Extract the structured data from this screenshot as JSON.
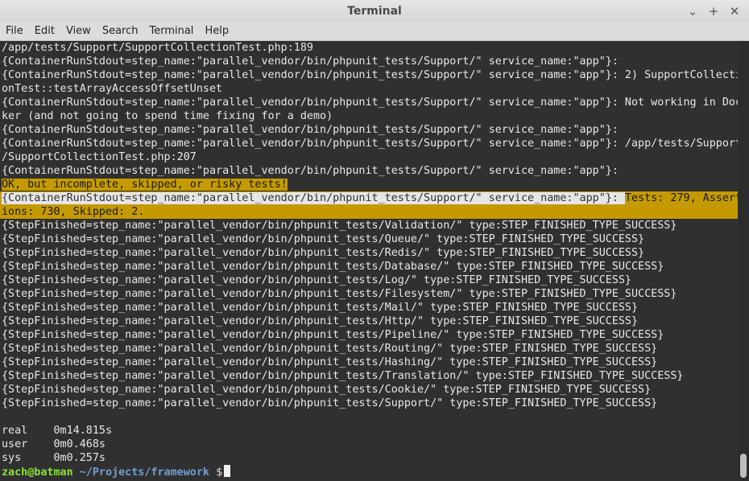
{
  "window": {
    "title": "Terminal",
    "controls": [
      "⌄",
      "+",
      "✕"
    ]
  },
  "menu": [
    "File",
    "Edit",
    "View",
    "Search",
    "Terminal",
    "Help"
  ],
  "terminal": {
    "lines": [
      {
        "text": "/app/tests/Support/SupportCollectionTest.php:189"
      },
      {
        "text": "{ContainerRunStdout=step_name:\"parallel_vendor/bin/phpunit_tests/Support/\" service_name:\"app\"}:"
      },
      {
        "text": "{ContainerRunStdout=step_name:\"parallel_vendor/bin/phpunit_tests/Support/\" service_name:\"app\"}: 2) SupportCollecti"
      },
      {
        "text": "onTest::testArrayAccessOffsetUnset"
      },
      {
        "text": "{ContainerRunStdout=step_name:\"parallel_vendor/bin/phpunit_tests/Support/\" service_name:\"app\"}: Not working in Doc"
      },
      {
        "text": "ker (and not going to spend time fixing for a demo)"
      },
      {
        "text": "{ContainerRunStdout=step_name:\"parallel_vendor/bin/phpunit_tests/Support/\" service_name:\"app\"}:"
      },
      {
        "text": "{ContainerRunStdout=step_name:\"parallel_vendor/bin/phpunit_tests/Support/\" service_name:\"app\"}: /app/tests/Support"
      },
      {
        "text": "/SupportCollectionTest.php:207"
      },
      {
        "text": "{ContainerRunStdout=step_name:\"parallel_vendor/bin/phpunit_tests/Support/\" service_name:\"app\"}:"
      },
      {
        "text": "OK, but incomplete, skipped, or risky tests!",
        "hl": "full"
      },
      {
        "text": "{ContainerRunStdout=step_name:\"parallel_vendor/bin/phpunit_tests/Support/\" service_name:\"app\"}: ",
        "hl": "label",
        "rest": "Tests: 279, Assert"
      },
      {
        "text": "ions: 730, Skipped: 2.",
        "hl": "row"
      },
      {
        "text": "{StepFinished=step_name:\"parallel_vendor/bin/phpunit_tests/Validation/\" type:STEP_FINISHED_TYPE_SUCCESS}"
      },
      {
        "text": "{StepFinished=step_name:\"parallel_vendor/bin/phpunit_tests/Queue/\" type:STEP_FINISHED_TYPE_SUCCESS}"
      },
      {
        "text": "{StepFinished=step_name:\"parallel_vendor/bin/phpunit_tests/Redis/\" type:STEP_FINISHED_TYPE_SUCCESS}"
      },
      {
        "text": "{StepFinished=step_name:\"parallel_vendor/bin/phpunit_tests/Database/\" type:STEP_FINISHED_TYPE_SUCCESS}"
      },
      {
        "text": "{StepFinished=step_name:\"parallel_vendor/bin/phpunit_tests/Log/\" type:STEP_FINISHED_TYPE_SUCCESS}"
      },
      {
        "text": "{StepFinished=step_name:\"parallel_vendor/bin/phpunit_tests/Filesystem/\" type:STEP_FINISHED_TYPE_SUCCESS}"
      },
      {
        "text": "{StepFinished=step_name:\"parallel_vendor/bin/phpunit_tests/Mail/\" type:STEP_FINISHED_TYPE_SUCCESS}"
      },
      {
        "text": "{StepFinished=step_name:\"parallel_vendor/bin/phpunit_tests/Http/\" type:STEP_FINISHED_TYPE_SUCCESS}"
      },
      {
        "text": "{StepFinished=step_name:\"parallel_vendor/bin/phpunit_tests/Pipeline/\" type:STEP_FINISHED_TYPE_SUCCESS}"
      },
      {
        "text": "{StepFinished=step_name:\"parallel_vendor/bin/phpunit_tests/Routing/\" type:STEP_FINISHED_TYPE_SUCCESS}"
      },
      {
        "text": "{StepFinished=step_name:\"parallel_vendor/bin/phpunit_tests/Hashing/\" type:STEP_FINISHED_TYPE_SUCCESS}"
      },
      {
        "text": "{StepFinished=step_name:\"parallel_vendor/bin/phpunit_tests/Translation/\" type:STEP_FINISHED_TYPE_SUCCESS}"
      },
      {
        "text": "{StepFinished=step_name:\"parallel_vendor/bin/phpunit_tests/Cookie/\" type:STEP_FINISHED_TYPE_SUCCESS}"
      },
      {
        "text": "{StepFinished=step_name:\"parallel_vendor/bin/phpunit_tests/Support/\" type:STEP_FINISHED_TYPE_SUCCESS}"
      },
      {
        "text": ""
      },
      {
        "text": "real    0m14.815s"
      },
      {
        "text": "user    0m0.468s"
      },
      {
        "text": "sys     0m0.257s"
      }
    ],
    "prompt": {
      "user_host": "zach@batman",
      "path": "~/Projects/framework",
      "symbol": "$"
    }
  }
}
